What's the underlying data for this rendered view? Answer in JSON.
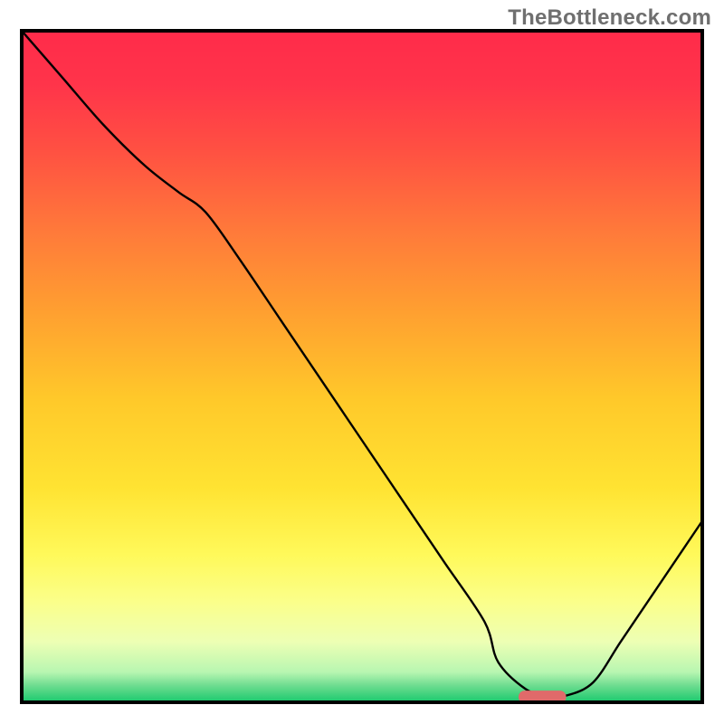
{
  "watermark": "TheBottleneck.com",
  "chart_data": {
    "type": "line",
    "title": "",
    "xlabel": "",
    "ylabel": "",
    "xlim": [
      0,
      100
    ],
    "ylim": [
      0,
      100
    ],
    "grid": false,
    "legend": false,
    "background": {
      "type": "vertical-gradient",
      "stops": [
        {
          "pct": 0.0,
          "color": "#ff2b4a"
        },
        {
          "pct": 0.08,
          "color": "#ff344a"
        },
        {
          "pct": 0.18,
          "color": "#ff5142"
        },
        {
          "pct": 0.3,
          "color": "#ff7a3a"
        },
        {
          "pct": 0.42,
          "color": "#ffa030"
        },
        {
          "pct": 0.55,
          "color": "#ffc92a"
        },
        {
          "pct": 0.68,
          "color": "#ffe332"
        },
        {
          "pct": 0.78,
          "color": "#fff95a"
        },
        {
          "pct": 0.85,
          "color": "#fbff8a"
        },
        {
          "pct": 0.91,
          "color": "#edffb4"
        },
        {
          "pct": 0.955,
          "color": "#b8f6b1"
        },
        {
          "pct": 0.975,
          "color": "#6edc90"
        },
        {
          "pct": 1.0,
          "color": "#19c96d"
        }
      ]
    },
    "series": [
      {
        "name": "bottleneck-curve",
        "color": "#000000",
        "width": 2.4,
        "x": [
          0,
          6,
          12,
          18,
          23,
          27,
          32,
          38,
          44,
          50,
          56,
          62,
          68,
          70,
          74,
          77,
          80,
          84,
          88,
          92,
          96,
          100
        ],
        "y": [
          100,
          93,
          86,
          80,
          76,
          73,
          66,
          57,
          48,
          39,
          30,
          21,
          12,
          6,
          2,
          1,
          1,
          3,
          9,
          15,
          21,
          27
        ]
      }
    ],
    "marker": {
      "name": "optimal-range-marker",
      "color": "#e06a6a",
      "opacity": 1.0,
      "shape": "rounded-pill",
      "x_range": [
        73,
        80
      ],
      "y": 0.8,
      "thickness_px": 14
    },
    "frame": {
      "color": "#000000",
      "width": 4
    }
  }
}
